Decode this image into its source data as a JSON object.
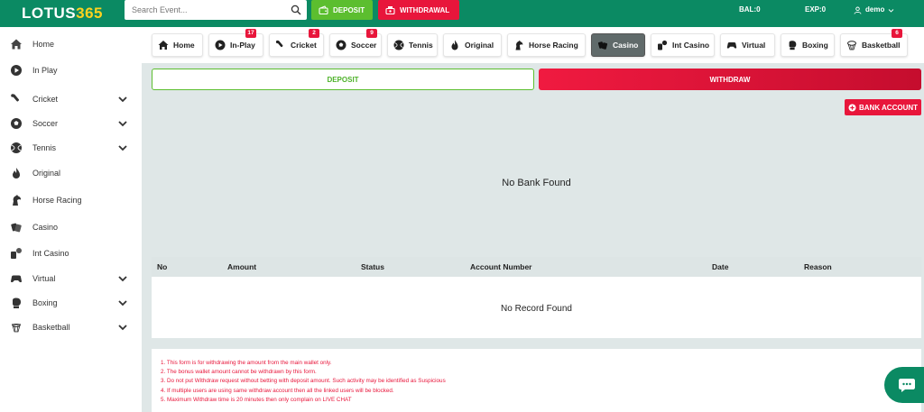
{
  "header": {
    "logo_main": "LOTUS",
    "logo_accent": "365",
    "search_placeholder": "Search Event...",
    "deposit_label": "DEPOSIT",
    "withdrawal_label": "WITHDRAWAL",
    "bal": "BAL:0",
    "exp": "EXP:0",
    "username": "demo"
  },
  "sidebar": {
    "items": [
      {
        "label": "Home",
        "icon": "home-icon"
      },
      {
        "label": "In Play",
        "icon": "play-icon"
      },
      {
        "label": "Cricket",
        "icon": "cricket-icon"
      },
      {
        "label": "Soccer",
        "icon": "soccer-icon"
      },
      {
        "label": "Tennis",
        "icon": "tennis-icon"
      },
      {
        "label": "Original",
        "icon": "flame-icon"
      },
      {
        "label": "Horse Racing",
        "icon": "horse-icon"
      },
      {
        "label": "Casino",
        "icon": "casino-icon"
      },
      {
        "label": "Int Casino",
        "icon": "int-casino-icon"
      },
      {
        "label": "Virtual",
        "icon": "gamepad-icon"
      },
      {
        "label": "Boxing",
        "icon": "boxing-icon"
      },
      {
        "label": "Basketball",
        "icon": "basketball-icon"
      }
    ]
  },
  "tabs": [
    {
      "label": "Home",
      "icon": "home-icon"
    },
    {
      "label": "In-Play",
      "badge": "17",
      "icon": "play-icon"
    },
    {
      "label": "Cricket",
      "badge": "2",
      "icon": "cricket-icon"
    },
    {
      "label": "Soccer",
      "badge": "9",
      "icon": "soccer-icon"
    },
    {
      "label": "Tennis",
      "icon": "tennis-icon"
    },
    {
      "label": "Original",
      "icon": "flame-icon"
    },
    {
      "label": "Horse Racing",
      "icon": "horse-icon"
    },
    {
      "label": "Casino",
      "icon": "casino-icon"
    },
    {
      "label": "Int Casino",
      "icon": "int-casino-icon"
    },
    {
      "label": "Virtual",
      "icon": "gamepad-icon"
    },
    {
      "label": "Boxing",
      "icon": "boxing-icon"
    },
    {
      "label": "Basketball",
      "badge": "6",
      "icon": "basketball-icon"
    }
  ],
  "main": {
    "deposit_tab": "DEPOSIT",
    "withdraw_tab": "WITHDRAW",
    "bank_account_button": "BANK ACCOUNT",
    "no_bank_text": "No Bank Found",
    "table": {
      "columns": [
        "No",
        "Amount",
        "Status",
        "Account Number",
        "Date",
        "Reason"
      ],
      "empty_text": "No Record Found"
    },
    "notes": [
      "1. This form is for withdrawing the amount from the main wallet only.",
      "2. The bonus wallet amount cannot be withdrawn by this form.",
      "3. Do not put Withdraw request without betting with deposit amount. Such activity may be identified as Suspicious",
      "4. If multiple users are using same withdraw account then all the linked users will be blocked.",
      "5. Maximum Withdraw time is 20 minutes then only complain on LIVE CHAT"
    ]
  },
  "colors": {
    "brand_green": "#0b8a63",
    "deposit_green": "#5cbe2f",
    "accent_red": "#e8163b",
    "logo_yellow": "#ffd21f"
  }
}
